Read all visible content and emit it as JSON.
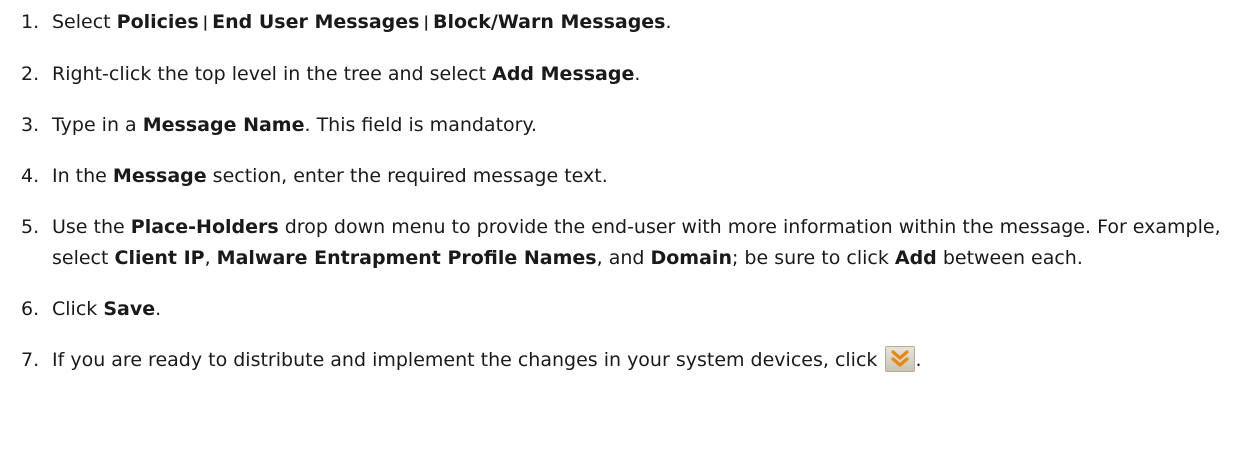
{
  "steps": [
    {
      "num": "1.",
      "t1": "Select ",
      "b1": "Policies",
      "sep1": "|",
      "b2": "End User Messages",
      "sep2": "|",
      "b3": "Block/Warn Messages",
      "t2": "."
    },
    {
      "num": "2.",
      "t1": "Right-click the top level in the tree and select ",
      "b1": "Add Message",
      "t2": "."
    },
    {
      "num": "3.",
      "t1": "Type in a ",
      "b1": "Message Name",
      "t2": ". This field is mandatory."
    },
    {
      "num": "4.",
      "t1": "In the ",
      "b1": "Message",
      "t2": " section, enter the required message text."
    },
    {
      "num": "5.",
      "t1": "Use the ",
      "b1": "Place-Holders",
      "t2": " drop down menu to provide the end-user with more information within the message. For example, select ",
      "b2": "Client IP",
      "t3": ", ",
      "b3": "Malware Entrapment Profile Names",
      "t4": ", and ",
      "b4": "Domain",
      "t5": "; be sure to click ",
      "b5": "Add",
      "t6": " between each."
    },
    {
      "num": "6.",
      "t1": "Click ",
      "b1": "Save",
      "t2": "."
    },
    {
      "num": "7.",
      "t1": "If you are ready to distribute and implement the changes in your system devices, click ",
      "icon": "deploy-changes-icon",
      "t2": "."
    }
  ],
  "colors": {
    "text": "#1a1a1a",
    "icon_chevron": "#e8870f",
    "icon_background": "#d8d4c6"
  }
}
